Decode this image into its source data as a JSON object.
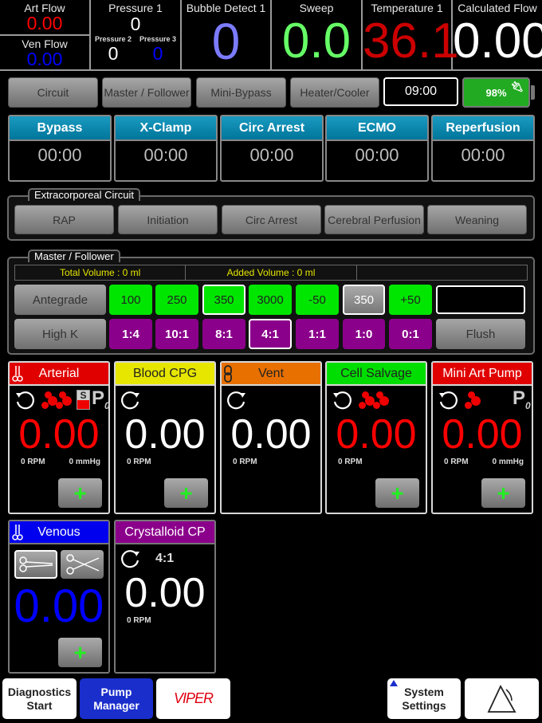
{
  "readouts": {
    "art_flow": {
      "label": "Art Flow",
      "value": "0.00",
      "color": "#ff0000"
    },
    "ven_flow": {
      "label": "Ven Flow",
      "value": "0.00",
      "color": "#0000ff"
    },
    "pressure1": {
      "label": "Pressure 1",
      "value": "0"
    },
    "pressure2": {
      "label": "Pressure 2",
      "value": "0"
    },
    "pressure3": {
      "label": "Pressure 3",
      "value": "0"
    },
    "bubble": {
      "label": "Bubble Detect 1",
      "value": "0",
      "color": "#7b7bff"
    },
    "sweep": {
      "label": "Sweep",
      "value": "0.0",
      "color": "#66ff66"
    },
    "temperature": {
      "label": "Temperature 1",
      "value": "36.1",
      "color": "#cc0000"
    },
    "calc_flow": {
      "label": "Calculated Flow",
      "value": "0.00"
    }
  },
  "nav": {
    "circuit": "Circuit",
    "master_follower": "Master / Follower",
    "mini_bypass": "Mini-Bypass",
    "heater_cooler": "Heater/Cooler",
    "clock": "09:00",
    "battery": "98%",
    "battery_fraction": 0.98
  },
  "timers": [
    {
      "label": "Bypass",
      "value": "00:00"
    },
    {
      "label": "X-Clamp",
      "value": "00:00"
    },
    {
      "label": "Circ Arrest",
      "value": "00:00"
    },
    {
      "label": "ECMO",
      "value": "00:00"
    },
    {
      "label": "Reperfusion",
      "value": "00:00"
    }
  ],
  "extracorporeal": {
    "title": "Extracorporeal Circuit",
    "buttons": [
      "RAP",
      "Initiation",
      "Circ Arrest",
      "Cerebral Perfusion",
      "Weaning"
    ]
  },
  "master_follower": {
    "title": "Master / Follower",
    "total_volume": "Total Volume : 0 ml",
    "added_volume": "Added Volume : 0 ml",
    "third_field": "",
    "antegrade": "Antegrade",
    "high_k": "High K",
    "flush": "Flush",
    "volume_buttons": [
      "100",
      "250",
      "350",
      "3000",
      "-50",
      "350",
      "+50"
    ],
    "selected_volume_index": 2,
    "ratio_buttons": [
      "1:4",
      "10:1",
      "8:1",
      "4:1",
      "1:1",
      "1:0",
      "0:1"
    ],
    "selected_ratio_index": 3,
    "custom_value": ""
  },
  "pumps": [
    {
      "name": "Arterial",
      "value": "0.00",
      "rpm": "0 RPM",
      "pressure": "0 mmHg",
      "header_color": "#e00000",
      "value_color": "#ff0000"
    },
    {
      "name": "Blood CPG",
      "value": "0.00",
      "rpm": "0 RPM",
      "header_color": "#e6e600",
      "value_color": "#ffffff"
    },
    {
      "name": "Vent",
      "value": "0.00",
      "rpm": "0 RPM",
      "header_color": "#e87000",
      "value_color": "#ffffff"
    },
    {
      "name": "Cell Salvage",
      "value": "0.00",
      "rpm": "0 RPM",
      "header_color": "#00dd00",
      "value_color": "#ff0000"
    },
    {
      "name": "Mini Art Pump",
      "value": "0.00",
      "rpm": "0 RPM",
      "pressure": "0 mmHg",
      "header_color": "#e00000",
      "value_color": "#ff0000"
    },
    {
      "name": "Venous",
      "value": "0.00",
      "header_color": "#0000ee",
      "value_color": "#0000ff"
    },
    {
      "name": "Crystalloid CP",
      "value": "0.00",
      "rpm": "0 RPM",
      "ratio": "4:1",
      "header_color": "#8b008b",
      "value_color": "#ffffff"
    }
  ],
  "icons": {
    "plus": "+",
    "sensor_s": "S",
    "sensor_p": "P",
    "sensor_p_sub": "0"
  },
  "bottom_nav": {
    "diagnostics_line1": "Diagnostics",
    "diagnostics_line2": "Start",
    "pump_manager_line1": "Pump",
    "pump_manager_line2": "Manager",
    "logo": "VIPER",
    "system_line1": "System",
    "system_line2": "Settings"
  }
}
